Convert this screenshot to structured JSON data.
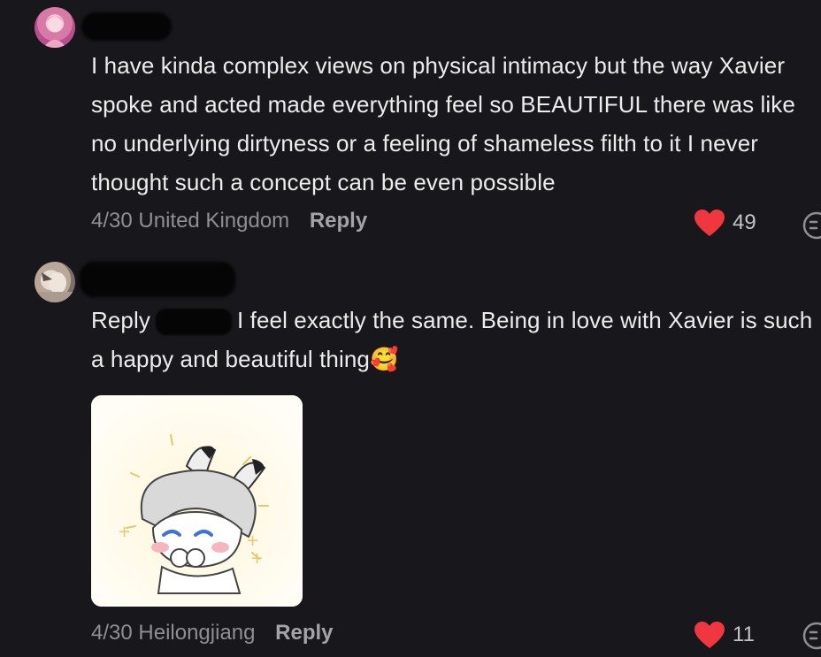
{
  "comments": [
    {
      "text": "I have kinda complex views on physical intimacy but the way Xavier spoke and acted made everything feel so BEAUTIFUL there was like no underlying dirtyness or a feeling of shameless filth to it I never thought such a concept can be even possible",
      "date": "4/30",
      "location": "United Kingdom",
      "reply_label": "Reply",
      "likes": "49",
      "like_icon": "heart-icon",
      "more_icon": "more-icon"
    },
    {
      "reply_prefix": "Reply",
      "text": "I feel exactly the same. Being in love with Xavier is such a happy and beautiful thing",
      "emoji": "🥰",
      "date": "4/30",
      "location": "Heilongjiang",
      "reply_label": "Reply",
      "likes": "11",
      "like_icon": "heart-icon",
      "more_icon": "more-icon"
    }
  ],
  "colors": {
    "background": "#18181c",
    "heart": "#f0363f",
    "meta": "#8e8e93"
  }
}
